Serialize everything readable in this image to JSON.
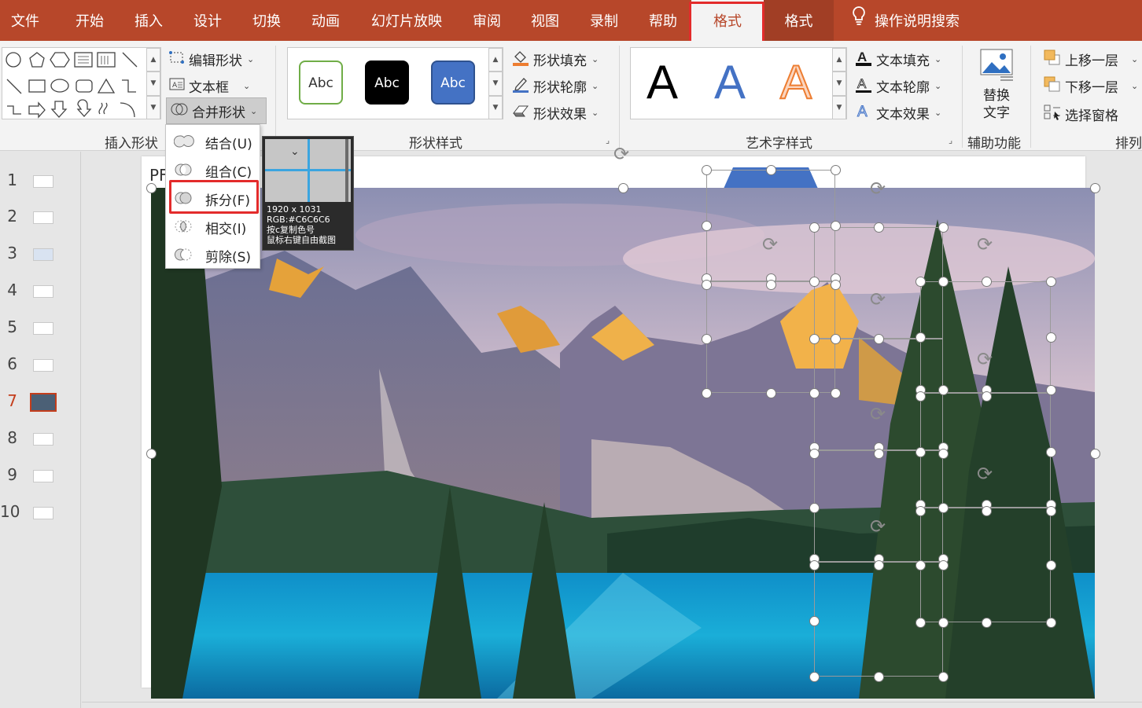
{
  "tabs": [
    {
      "label": "文件"
    },
    {
      "label": "开始"
    },
    {
      "label": "插入"
    },
    {
      "label": "设计"
    },
    {
      "label": "切换"
    },
    {
      "label": "动画"
    },
    {
      "label": "幻灯片放映"
    },
    {
      "label": "审阅"
    },
    {
      "label": "视图"
    },
    {
      "label": "录制"
    },
    {
      "label": "帮助"
    },
    {
      "label": "格式"
    },
    {
      "label": "格式"
    }
  ],
  "search_label": "操作说明搜索",
  "ribbon": {
    "insert_shapes": {
      "edit_shape": "编辑形状",
      "text_box": "文本框",
      "merge_shapes": "合并形状",
      "group_label": "插入形状"
    },
    "shape_styles": {
      "preset_text": [
        "Abc",
        "Abc",
        "Abc"
      ],
      "shape_fill": "形状填充",
      "shape_outline": "形状轮廓",
      "shape_effects": "形状效果",
      "group_label": "形状样式"
    },
    "wordart": {
      "letters": [
        "A",
        "A",
        "A"
      ],
      "text_fill": "文本填充",
      "text_outline": "文本轮廓",
      "text_effects": "文本效果",
      "group_label": "艺术字样式"
    },
    "accessibility": {
      "alt_text_line1": "替换",
      "alt_text_line2": "文字",
      "group_label": "辅助功能"
    },
    "arrange": {
      "bring_forward": "上移一层",
      "send_backward": "下移一层",
      "selection_pane": "选择窗格",
      "group_label": "排列"
    }
  },
  "merge_menu": {
    "items": [
      {
        "label": "结合(U)"
      },
      {
        "label": "组合(C)"
      },
      {
        "label": "拆分(F)"
      },
      {
        "label": "相交(I)"
      },
      {
        "label": "剪除(S)"
      }
    ]
  },
  "magnifier": {
    "size": "1920 x 1031",
    "rgb": "RGB:#C6C6C6",
    "hint1": "按c复制色号",
    "hint2": "鼠标右键自由截图"
  },
  "slides": [
    {
      "num": "1"
    },
    {
      "num": "2"
    },
    {
      "num": "3"
    },
    {
      "num": "4"
    },
    {
      "num": "5"
    },
    {
      "num": "6"
    },
    {
      "num": "7"
    },
    {
      "num": "8"
    },
    {
      "num": "9"
    },
    {
      "num": "10"
    }
  ],
  "slide_title_fragment": "PF",
  "colors": {
    "accent": "#b7472a",
    "highlight": "#e32b2b",
    "selected_slide": "#c43e1c"
  }
}
